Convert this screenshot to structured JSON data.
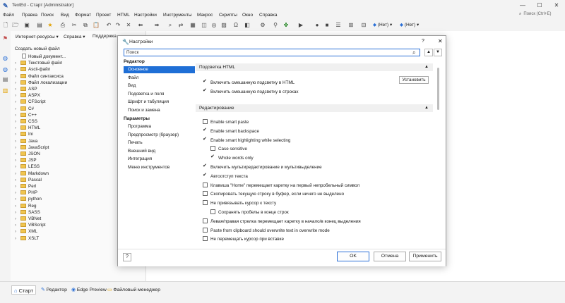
{
  "window": {
    "title": "TextEd - Старт [Administrator]",
    "logo_icon": "texted-logo-icon"
  },
  "menu": [
    "Файл",
    "Правка",
    "Поиск",
    "Вид",
    "Формат",
    "Проект",
    "HTML",
    "Настройки",
    "Инструменты",
    "Макрос",
    "Скрипты",
    "Окно",
    "Справка"
  ],
  "search": {
    "placeholder": "Поиск (Ctrl+E)"
  },
  "toolbar": {
    "dropdown1": "(Нет)",
    "dropdown2": "(Нет)"
  },
  "nav": {
    "internet": "Интернет-ресурсы",
    "help": "Справка",
    "support": "Поддержка"
  },
  "tree": {
    "heading": "Создать новый файл",
    "items": [
      {
        "label": "Новый документ...",
        "kind": "doc"
      },
      {
        "label": "Текстовый файл",
        "kind": "folder"
      },
      {
        "label": "Ascii-файл",
        "kind": "folder"
      },
      {
        "label": "Файл синтаксиса",
        "kind": "folder"
      },
      {
        "label": "Файл локализации",
        "kind": "folder"
      },
      {
        "label": "ASP",
        "kind": "folder"
      },
      {
        "label": "ASPX",
        "kind": "folder"
      },
      {
        "label": "CFScript",
        "kind": "folder"
      },
      {
        "label": "C#",
        "kind": "folder"
      },
      {
        "label": "C++",
        "kind": "folder"
      },
      {
        "label": "CSS",
        "kind": "folder"
      },
      {
        "label": "HTML",
        "kind": "folder"
      },
      {
        "label": "Ini",
        "kind": "folder"
      },
      {
        "label": "Java",
        "kind": "folder"
      },
      {
        "label": "JavaScript",
        "kind": "folder"
      },
      {
        "label": "JSON",
        "kind": "folder"
      },
      {
        "label": "JSP",
        "kind": "folder"
      },
      {
        "label": "LESS",
        "kind": "folder"
      },
      {
        "label": "Markdown",
        "kind": "folder"
      },
      {
        "label": "Pascal",
        "kind": "folder"
      },
      {
        "label": "Perl",
        "kind": "folder"
      },
      {
        "label": "PHP",
        "kind": "folder"
      },
      {
        "label": "python",
        "kind": "folder"
      },
      {
        "label": "Reg",
        "kind": "folder"
      },
      {
        "label": "SASS",
        "kind": "folder"
      },
      {
        "label": "VBNet",
        "kind": "folder"
      },
      {
        "label": "VBScript",
        "kind": "folder"
      },
      {
        "label": "XML",
        "kind": "folder"
      },
      {
        "label": "XSLT",
        "kind": "folder"
      }
    ]
  },
  "bottom_tabs": [
    "Старт",
    "Редактор",
    "Edge Preview",
    "Файловый менеджер"
  ],
  "dialog": {
    "title": "Настройки",
    "help": "?",
    "search_value": "Поиск",
    "categories": {
      "group1": "Редактор",
      "group1_items": [
        "Основное",
        "Файл",
        "Вид",
        "Подсветка и поля",
        "Шрифт и табуляция",
        "Поиск и замена"
      ],
      "group2": "Параметры",
      "group2_items": [
        "Программа",
        "Предпросмотр (браузер)",
        "Печать",
        "Внешний вид",
        "Интеграция",
        "Меню инструментов"
      ]
    },
    "section1": {
      "title": "Подсветка HTML",
      "options": [
        {
          "label": "Включить смешанную подсветку в HTML",
          "checked": true
        },
        {
          "label": "Включить смешанную подсветку в строках",
          "checked": true
        }
      ],
      "install_button": "Установить"
    },
    "section2": {
      "title": "Редактирование",
      "options": [
        {
          "label": "Enable smart paste",
          "checked": false,
          "indent": 0
        },
        {
          "label": "Enable smart backspace",
          "checked": true,
          "indent": 0
        },
        {
          "label": "Enable smart highlighting while selecting",
          "checked": true,
          "indent": 0
        },
        {
          "label": "Case sensitive",
          "checked": false,
          "indent": 1
        },
        {
          "label": "Whole words only",
          "checked": true,
          "indent": 1
        },
        {
          "label": "Включить мультиредактирование и мультивыделение",
          "checked": true,
          "indent": 0
        },
        {
          "label": "Автоотступ текста",
          "checked": true,
          "indent": 0
        },
        {
          "label": "Клавиша \"Home\" перемещает каретку на первый непробельный символ",
          "checked": false,
          "indent": 0
        },
        {
          "label": "Скопировать текущую строку в буфер, если ничего не выделено",
          "checked": false,
          "indent": 0
        },
        {
          "label": "Не привязывать курсор к тексту",
          "checked": false,
          "indent": 0
        },
        {
          "label": "Сохранять пробелы в конце строк",
          "checked": false,
          "indent": 1
        },
        {
          "label": "Левая/правая стрелка перемещает каретку в начало/в конец выделения",
          "checked": false,
          "indent": 0
        },
        {
          "label": "Paste from clipboard should overwrite text in overwrite mode",
          "checked": false,
          "indent": 0
        },
        {
          "label": "Не перемещать курсор при вставке",
          "checked": false,
          "indent": 0
        }
      ]
    },
    "buttons": {
      "ok": "OK",
      "cancel": "Отмена",
      "apply": "Применить"
    }
  },
  "colors": {
    "accent": "#1f6fd6",
    "folder": "#f0c550"
  }
}
